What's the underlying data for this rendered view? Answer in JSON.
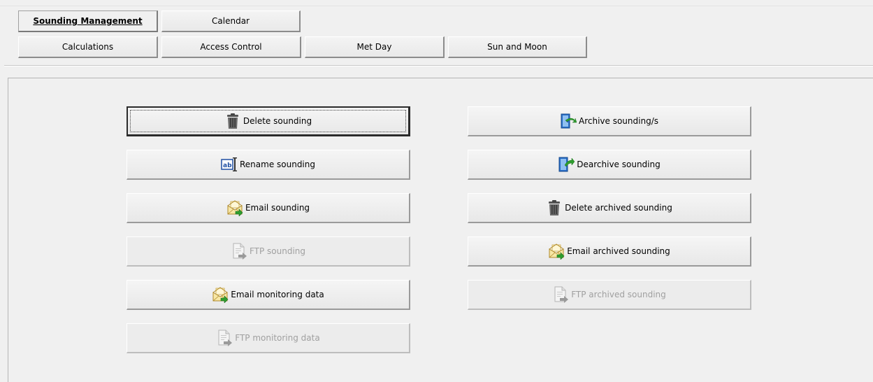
{
  "tabs_row1": [
    {
      "label": "Sounding Management",
      "active": true
    },
    {
      "label": "Calendar",
      "active": false
    }
  ],
  "tabs_row2": [
    {
      "label": "Calculations"
    },
    {
      "label": "Access Control"
    },
    {
      "label": "Met Day"
    },
    {
      "label": "Sun and Moon"
    }
  ],
  "actions": {
    "delete_sounding": {
      "label": "Delete sounding",
      "icon": "trash-icon"
    },
    "rename_sounding": {
      "label": "Rename sounding",
      "icon": "rename-icon"
    },
    "email_sounding": {
      "label": "Email sounding",
      "icon": "email-icon"
    },
    "ftp_sounding": {
      "label": "FTP sounding",
      "icon": "ftp-document-icon",
      "disabled": true
    },
    "email_monitoring_data": {
      "label": "Email monitoring data",
      "icon": "email-icon"
    },
    "ftp_monitoring_data": {
      "label": "FTP monitoring data",
      "icon": "ftp-document-icon",
      "disabled": true
    },
    "archive_soundings": {
      "label": "Archive sounding/s",
      "icon": "archive-icon"
    },
    "dearchive_sounding": {
      "label": "Dearchive sounding",
      "icon": "dearchive-icon"
    },
    "delete_archived_sounding": {
      "label": "Delete archived sounding",
      "icon": "trash-icon"
    },
    "email_archived_sounding": {
      "label": "Email archived sounding",
      "icon": "email-icon"
    },
    "ftp_archived_sounding": {
      "label": "FTP archived sounding",
      "icon": "ftp-document-icon",
      "disabled": true
    }
  },
  "colors": {
    "background": "#f0f0f0",
    "disabled_text": "#a0a0a0",
    "email_arrow": "#2e9e2e",
    "archive_blue": "#2a6fc9"
  }
}
